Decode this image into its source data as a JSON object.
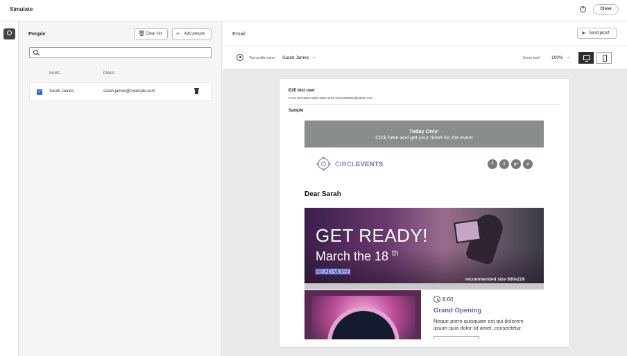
{
  "header": {
    "title": "Simulate",
    "help_icon": "help-icon",
    "close_label": "Close"
  },
  "rail": {
    "icon": "user-circle-icon"
  },
  "people": {
    "title": "People",
    "clear_label": "Clear list",
    "add_label": "Add people",
    "search_placeholder": "",
    "columns": {
      "name": "NAME",
      "email": "EMAIL"
    },
    "rows": [
      {
        "name": "Sarah James",
        "email": "sarah.james@example.com",
        "checked": true
      }
    ]
  },
  "email": {
    "title": "Email",
    "send_label": "Send proof",
    "profile_label": "Test profile name",
    "profile_value": "Sarah James",
    "zoom_label": "Zoom level",
    "zoom_value": "100%",
    "view_mode": "desktop",
    "preview": {
      "subject": "E2E test user",
      "from": "From c67e9de9-0de0-498e-a182-fcf3c6d96552@adobe.com",
      "preheader": "Sample",
      "banner_line1": "Today Only:",
      "banner_line2": "Click here and get your ticket for the event",
      "logo_text_a": "CIRCL",
      "logo_text_b": "EVENTS",
      "social": [
        "f",
        "t",
        "g+",
        "yt"
      ],
      "greeting": "Dear Sarah",
      "hero_title": "GET READY!",
      "hero_date": "March the 18",
      "hero_date_sup": "th",
      "hero_link": "READ MORE",
      "hero_note": "recommended size 660x228",
      "event_time": "8:00",
      "event_title": "Grand Opening",
      "event_desc": "Neque porro quisquam est qui dolorem ipsum quia dolor sit amet, consectetur."
    }
  },
  "colors": {
    "accent": "#2b6fd6",
    "brand": "#6a70b8",
    "banner": "#8a8d8d"
  }
}
